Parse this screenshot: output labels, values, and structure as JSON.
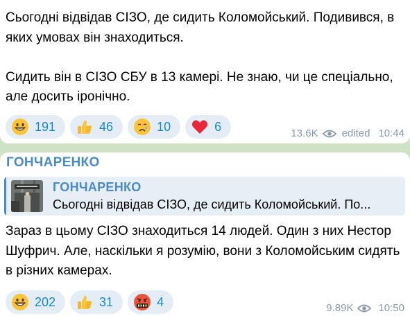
{
  "message1": {
    "paragraphs": [
      "Сьогодні відвідав СІЗО, де сидить Коломойський. Подивився, в яких умовах він знаходиться.",
      "Сидить він в СІЗО СБУ в 13 камері. Не знаю, чи це спеціально, але досить іронічно."
    ],
    "reactions": [
      {
        "emoji": "grinning-face",
        "count": "191"
      },
      {
        "emoji": "thumbs-up",
        "count": "46"
      },
      {
        "emoji": "crying-face",
        "count": "10"
      },
      {
        "emoji": "red-heart",
        "count": "6"
      }
    ],
    "views": "13.6K",
    "edited_label": "edited",
    "time": "10:44"
  },
  "message2": {
    "channel_name": "ГОНЧАРЕНКО",
    "reply": {
      "title": "ГОНЧАРЕНКО",
      "text": "Сьогодні відвідав СІЗО, де сидить Коломойський. По..."
    },
    "paragraphs": [
      "Зараз в цьому СІЗО знаходиться 14 людей. Один з них Нестор Шуфрич. Але, наскільки я розумію, вони з Коломойським сидять в різних камерах."
    ],
    "reactions": [
      {
        "emoji": "grinning-face",
        "count": "202"
      },
      {
        "emoji": "thumbs-up",
        "count": "31"
      },
      {
        "emoji": "cursing-face",
        "count": "4"
      }
    ],
    "views": "9.89K",
    "time": "10:50"
  },
  "colors": {
    "background": "#cfe2c6",
    "accent": "#4a8bc7",
    "reaction_bg": "#e4edf5",
    "reaction_text": "#168acd",
    "meta_text": "#8a9aa8"
  }
}
